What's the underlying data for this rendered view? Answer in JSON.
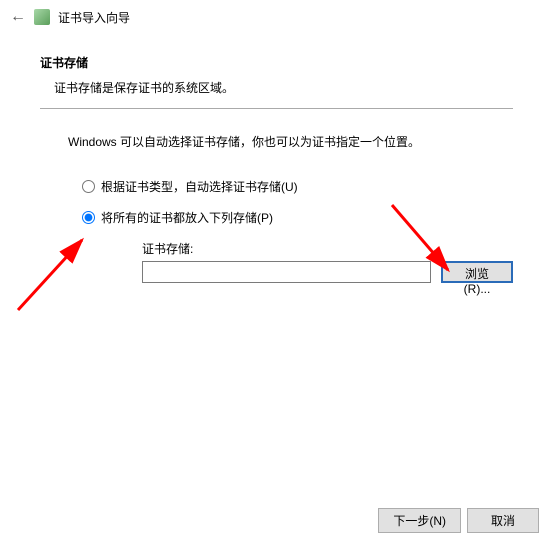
{
  "header": {
    "title": "证书导入向导"
  },
  "section": {
    "title": "证书存储",
    "description": "证书存储是保存证书的系统区域。"
  },
  "info_text": "Windows 可以自动选择证书存储，你也可以为证书指定一个位置。",
  "radio": {
    "auto_label": "根据证书类型，自动选择证书存储(U)",
    "manual_label": "将所有的证书都放入下列存储(P)"
  },
  "store": {
    "label": "证书存储:",
    "value": "",
    "browse_label": "浏览(R)..."
  },
  "footer": {
    "next_label": "下一步(N)",
    "cancel_label": "取消"
  }
}
